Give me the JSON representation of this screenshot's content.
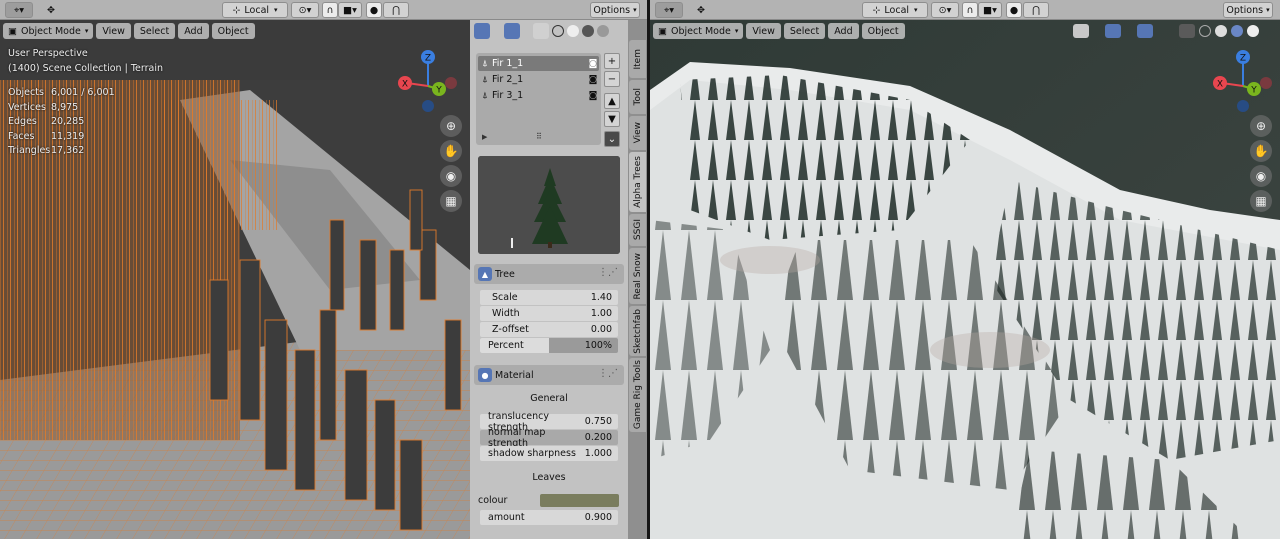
{
  "left_toolbar": {
    "orientation": "Local",
    "options": "Options"
  },
  "right_toolbar": {
    "orientation": "Local",
    "options": "Options"
  },
  "left_viewport": {
    "mode": "Object Mode",
    "menu": [
      "View",
      "Select",
      "Add",
      "Object"
    ],
    "view_name": "User Perspective",
    "collection": "(1400) Scene Collection | Terrain",
    "stats": [
      {
        "label": "Objects",
        "value": "6,001 / 6,001"
      },
      {
        "label": "Vertices",
        "value": "8,975"
      },
      {
        "label": "Edges",
        "value": "20,285"
      },
      {
        "label": "Faces",
        "value": "11,319"
      },
      {
        "label": "Triangles",
        "value": "17,362"
      }
    ],
    "gizmo_axes": {
      "x": "X",
      "y": "Y",
      "z": "Z"
    }
  },
  "right_viewport": {
    "mode": "Object Mode",
    "menu": [
      "View",
      "Select",
      "Add",
      "Object"
    ],
    "gizmo_axes": {
      "x": "X",
      "y": "Y",
      "z": "Z"
    }
  },
  "sidebar": {
    "tabs": [
      "Item",
      "Tool",
      "View",
      "Alpha Trees",
      "SSGI",
      "Real Snow",
      "Sketchfab",
      "Game Rig Tools"
    ],
    "active_tab": "Alpha Trees",
    "tree_list": [
      "Fir 1_1",
      "Fir 2_1",
      "Fir 3_1"
    ],
    "tree_panel": {
      "title": "Tree",
      "scale_label": "Scale",
      "scale_value": "1.40",
      "width_label": "Width",
      "width_value": "1.00",
      "zoffset_label": "Z-offset",
      "zoffset_value": "0.00",
      "percent_label": "Percent",
      "percent_value": "100%",
      "percent_fraction": 0.5
    },
    "material_panel": {
      "title": "Material",
      "general_label": "General",
      "translucency_label": "translucency strength",
      "translucency_value": "0.750",
      "normal_label": "normal map strength",
      "normal_value": "0.200",
      "shadow_label": "shadow sharpness",
      "shadow_value": "1.000",
      "leaves_label": "Leaves",
      "colour_label": "colour",
      "colour_hex": "#7a7d5e",
      "amount_label": "amount",
      "amount_value": "0.900"
    }
  },
  "colors": {
    "selection_orange": "#e07a2a",
    "axis_x": "#e8464f",
    "axis_y": "#7ab51e",
    "axis_z": "#3a7ee0",
    "toolbar_bg": "#b3b3b3",
    "panel_bg": "#c2c2c2"
  }
}
